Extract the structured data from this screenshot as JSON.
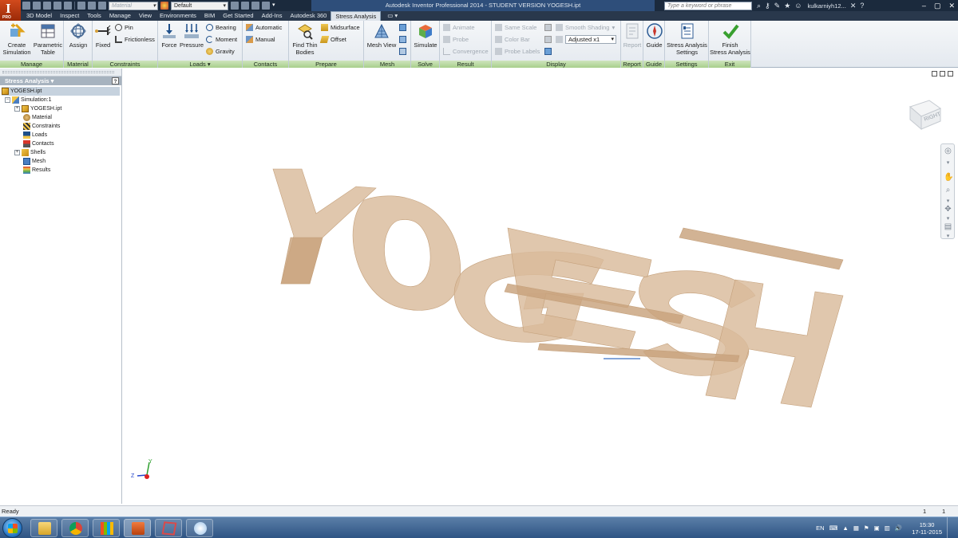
{
  "app": {
    "logo_text": "I",
    "logo_sub": "PRO",
    "window_title": "Autodesk Inventor Professional 2014 - STUDENT VERSION   YOGESH.ipt",
    "search_placeholder": "Type a keyword or phrase",
    "user": "kulkarniyh12...",
    "material_combo": "Material",
    "appearance_combo": "Default"
  },
  "tabs": [
    {
      "label": "3D Model",
      "active": false
    },
    {
      "label": "Inspect",
      "active": false
    },
    {
      "label": "Tools",
      "active": false
    },
    {
      "label": "Manage",
      "active": false
    },
    {
      "label": "View",
      "active": false
    },
    {
      "label": "Environments",
      "active": false
    },
    {
      "label": "BIM",
      "active": false
    },
    {
      "label": "Get Started",
      "active": false
    },
    {
      "label": "Add-Ins",
      "active": false
    },
    {
      "label": "Autodesk 360",
      "active": false
    },
    {
      "label": "Stress Analysis",
      "active": true
    }
  ],
  "tab_extra": "▭ ▾",
  "ribbon": {
    "manage": {
      "label": "Manage",
      "create_simulation": "Create\nSimulation",
      "parametric_table": "Parametric\nTable"
    },
    "material": {
      "label": "Material",
      "assign": "Assign"
    },
    "constraints": {
      "label": "Constraints",
      "fixed": "Fixed",
      "pin": "Pin",
      "frictionless": "Frictionless"
    },
    "loads": {
      "label": "Loads ▾",
      "force": "Force",
      "pressure": "Pressure",
      "bearing": "Bearing",
      "moment": "Moment",
      "gravity": "Gravity"
    },
    "contacts": {
      "label": "Contacts",
      "automatic": "Automatic",
      "manual": "Manual"
    },
    "prepare": {
      "label": "Prepare",
      "find_thin_bodies": "Find Thin\nBodies",
      "midsurface": "Midsurface",
      "offset": "Offset"
    },
    "mesh": {
      "label": "Mesh",
      "mesh_view": "Mesh View"
    },
    "solve": {
      "label": "Solve",
      "simulate": "Simulate"
    },
    "result": {
      "label": "Result",
      "animate": "Animate",
      "probe": "Probe",
      "convergence": "Convergence"
    },
    "display": {
      "label": "Display",
      "same_scale": "Same Scale",
      "color_bar": "Color Bar",
      "probe_labels": "Probe Labels",
      "smooth_shading": "Smooth Shading",
      "adjusted": "Adjusted x1"
    },
    "report": {
      "label": "Report",
      "report": "Report"
    },
    "guide": {
      "label": "Guide",
      "guide": "Guide"
    },
    "settings": {
      "label": "Settings",
      "stress_analysis_settings": "Stress Analysis\nSettings"
    },
    "exit": {
      "label": "Exit",
      "finish": "Finish\nStress Analysis"
    }
  },
  "browser": {
    "title": "Stress Analysis ▾",
    "help": "?",
    "tree": [
      {
        "label": "YOGESH.ipt"
      },
      {
        "label": "Simulation:1"
      },
      {
        "label": "YOGESH.ipt"
      },
      {
        "label": "Material"
      },
      {
        "label": "Constraints"
      },
      {
        "label": "Loads"
      },
      {
        "label": "Contacts"
      },
      {
        "label": "Shells"
      },
      {
        "label": "Mesh"
      },
      {
        "label": "Results"
      }
    ]
  },
  "viewcube": {
    "face": "RIGHT"
  },
  "triad": {
    "y": "Y",
    "z": "Z"
  },
  "status": {
    "text": "Ready",
    "n1": "1",
    "n2": "1"
  },
  "tray": {
    "lang": "EN",
    "time": "15:30",
    "date": "17-11-2015"
  },
  "colors": {
    "model": "#d9bb9b",
    "ribbon_label": "#a8cf8c",
    "title_bar": "#1b2a3d",
    "taskbar": "#2e5484"
  }
}
